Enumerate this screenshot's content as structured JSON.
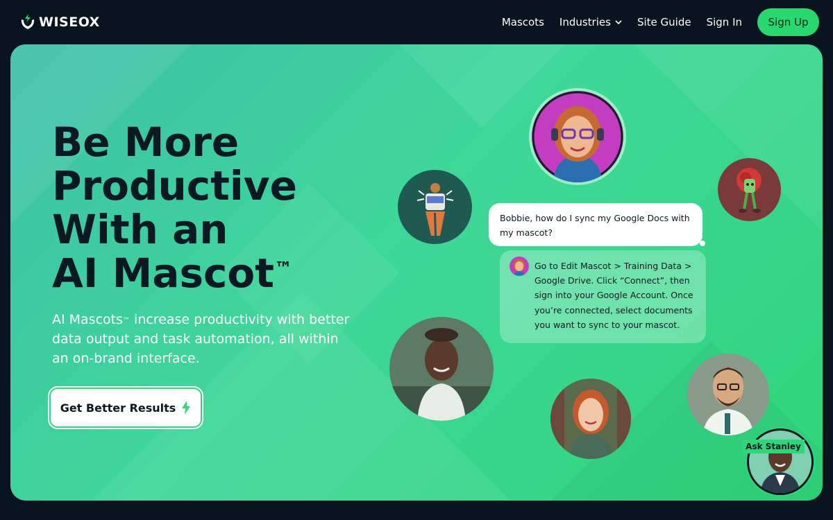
{
  "nav": {
    "logo_text": "WISEOX",
    "links": [
      "Mascots",
      "Industries",
      "Site Guide",
      "Sign In"
    ],
    "signup_label": "Sign Up"
  },
  "hero": {
    "headline_lines": [
      "Be More",
      "Productive",
      "With an",
      "AI Mascot"
    ],
    "headline_tm": "™",
    "subtext_parts": [
      "AI Mascots",
      "™",
      " increase productivity with better data output and task automation, all within an on-brand interface."
    ],
    "cta_label": "Get Better Results"
  },
  "chat": {
    "user_message": "Bobbie, how do I sync my Google Docs with my mascot?",
    "bot_message": "Go to Edit Mascot > Training Data > Google Drive. Click “Connect”, then sign into your Google Account. Once you’re connected, select documents you want to sync to your mascot."
  },
  "widget": {
    "ask_label": "Ask Stanley"
  },
  "colors": {
    "nav_bg": "#0a141f",
    "accent_green": "#29d66f",
    "hero_gradient_start": "#3dbfa8",
    "hero_gradient_end": "#2fd67a",
    "headline_text": "#0b1a22"
  },
  "icons": [
    "wiseox-logo-icon",
    "chevron-down-icon",
    "lightning-bolt-icon"
  ]
}
